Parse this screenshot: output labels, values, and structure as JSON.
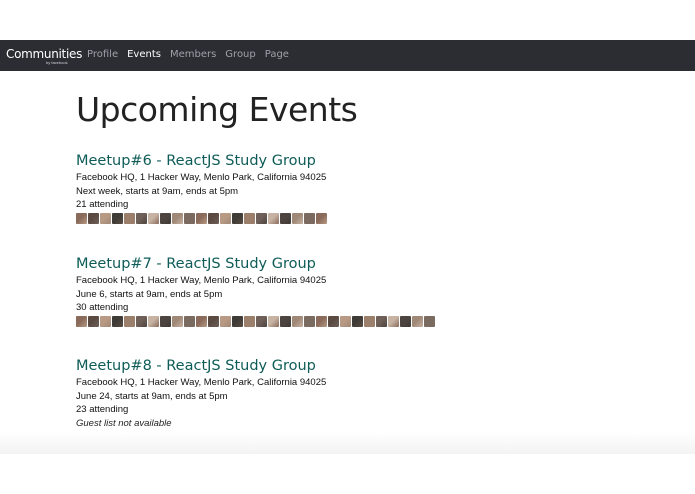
{
  "nav": {
    "brand": "Communities",
    "brand_sub": "by facebook",
    "links": [
      "Profile",
      "Events",
      "Members",
      "Group",
      "Page"
    ],
    "active": "Events"
  },
  "page": {
    "title": "Upcoming Events"
  },
  "events": [
    {
      "title": "Meetup#6 - ReactJS Study Group",
      "location": "Facebook HQ, 1 Hacker Way, Menlo Park, California 94025",
      "when": "Next week, starts at 9am, ends at 5pm",
      "attending": "21 attending",
      "attendees_shown": 21
    },
    {
      "title": "Meetup#7 - ReactJS Study Group",
      "location": "Facebook HQ, 1 Hacker Way, Menlo Park, California 94025",
      "when": "June 6, starts at 9am, ends at 5pm",
      "attending": "30 attending",
      "attendees_shown": 30
    },
    {
      "title": "Meetup#8 - ReactJS Study Group",
      "location": "Facebook HQ, 1 Hacker Way, Menlo Park, California 94025",
      "when": "June 24, starts at 9am, ends at 5pm",
      "attending": "23 attending",
      "guest_list_note": "Guest list not available"
    }
  ],
  "colors": {
    "navbar": "#2b2d33",
    "event_title": "#0e5c57",
    "avatar_tones": [
      "#8a6a5a",
      "#5a4a42",
      "#b89a84",
      "#3e3a36",
      "#9c7f6b",
      "#6f6059",
      "#c7b3a3",
      "#4d4440",
      "#a08877",
      "#7b6a60"
    ]
  }
}
